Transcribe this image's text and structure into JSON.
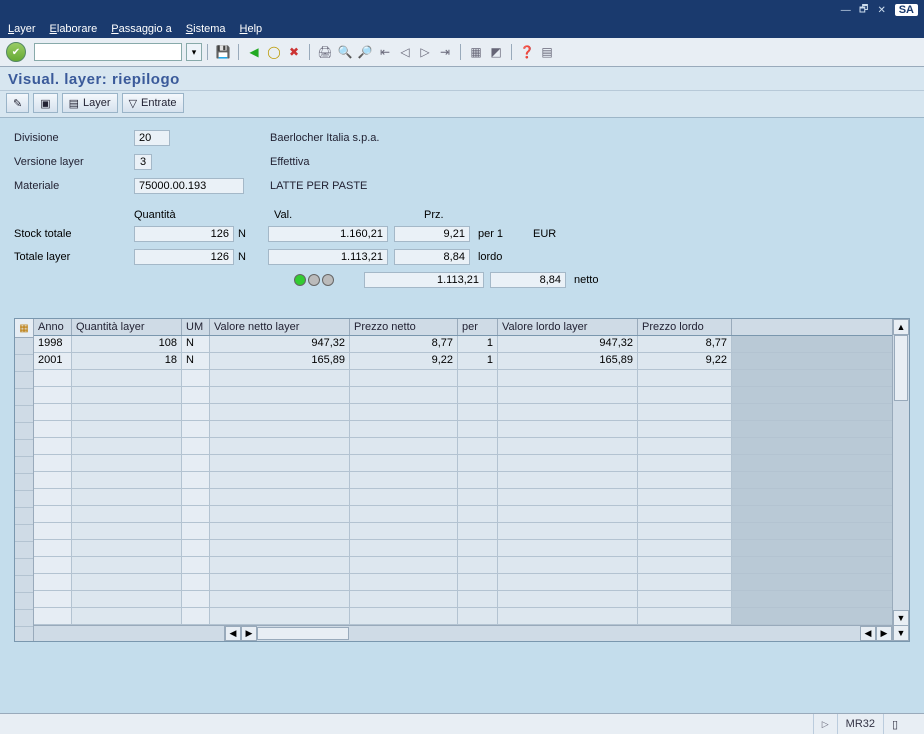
{
  "window": {
    "title": "",
    "logo": "SA"
  },
  "menu": [
    "Layer",
    "Elaborare",
    "Passaggio a",
    "Sistema",
    "Help"
  ],
  "page_title": "Visual. layer: riepilogo",
  "appbar": {
    "layer_btn": "Layer",
    "entrate_btn": "Entrate"
  },
  "form": {
    "divisione_label": "Divisione",
    "divisione_value": "20",
    "divisione_text": "Baerlocher Italia  s.p.a.",
    "versione_label": "Versione layer",
    "versione_value": "3",
    "versione_text": "Effettiva",
    "materiale_label": "Materiale",
    "materiale_value": "75000.00.193",
    "materiale_text": "LATTE PER PASTE"
  },
  "sum": {
    "hdr_qty": "Quantità",
    "hdr_val": "Val.",
    "hdr_prz": "Prz.",
    "stock_label": "Stock totale",
    "stock_qty": "126",
    "stock_um": "N",
    "stock_val": "1.160,21",
    "stock_prz": "9,21",
    "stock_per": "per  1",
    "stock_cur": "EUR",
    "layer_label": "Totale layer",
    "layer_qty": "126",
    "layer_um": "N",
    "layer_val": "1.113,21",
    "layer_prz": "8,84",
    "layer_tag": "lordo",
    "net_val": "1.113,21",
    "net_prz": "8,84",
    "net_tag": "netto"
  },
  "grid": {
    "headers": {
      "anno": "Anno",
      "qty": "Quantità layer",
      "um": "UM",
      "vn": "Valore netto layer",
      "pn": "Prezzo netto",
      "per": "per",
      "vl": "Valore lordo layer",
      "pl": "Prezzo lordo"
    },
    "rows": [
      {
        "anno": "1998",
        "qty": "108",
        "um": "N",
        "vn": "947,32",
        "pn": "8,77",
        "per": "1",
        "vl": "947,32",
        "pl": "8,77"
      },
      {
        "anno": "2001",
        "qty": "18",
        "um": "N",
        "vn": "165,89",
        "pn": "9,22",
        "per": "1",
        "vl": "165,89",
        "pl": "9,22"
      }
    ],
    "empty_rows": 15
  },
  "status": {
    "tcode": "MR32",
    "sep": "▷"
  }
}
